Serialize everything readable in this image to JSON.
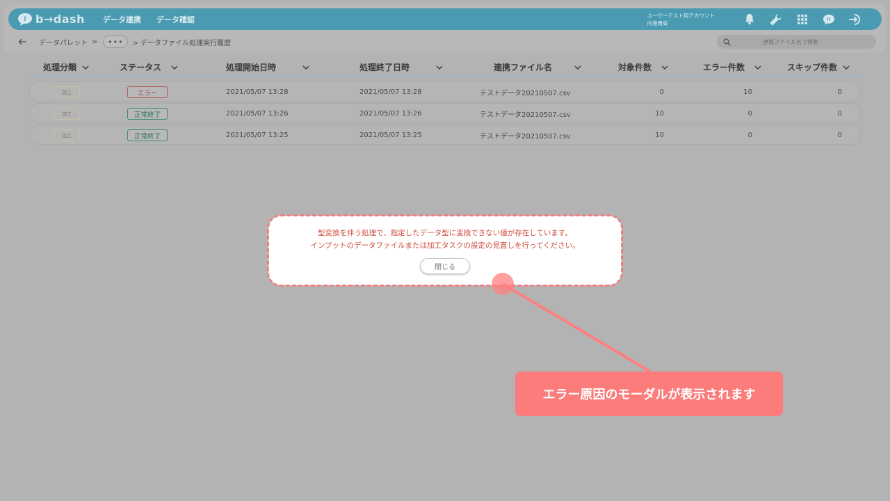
{
  "header": {
    "logo_text": "b→dash",
    "nav": [
      "データ連携",
      "データ確認"
    ],
    "user_line1": "ユーザーテスト用アカウント",
    "user_line2": "向後貴東"
  },
  "subbar": {
    "crumb1": "データパレット",
    "sep": ">",
    "more": "•••",
    "current": "> データファイル処理実行履歴",
    "search_placeholder": "連携ファイル名で検索"
  },
  "table": {
    "columns": [
      "処理分類",
      "ステータス",
      "処理開始日時",
      "処理終了日時",
      "連携ファイル名",
      "対象件数",
      "エラー件数",
      "スキップ件数"
    ],
    "rows": [
      {
        "type": "加工",
        "status": "エラー",
        "status_kind": "error",
        "start": "2021/05/07 13:28",
        "end": "2021/05/07 13:28",
        "file": "テストデータ20210507.csv",
        "target": "0",
        "errors": "10",
        "skips": "0"
      },
      {
        "type": "加工",
        "status": "正常終了",
        "status_kind": "ok",
        "start": "2021/05/07 13:26",
        "end": "2021/05/07 13:26",
        "file": "テストデータ20210507.csv",
        "target": "10",
        "errors": "0",
        "skips": "0"
      },
      {
        "type": "加工",
        "status": "正常終了",
        "status_kind": "ok",
        "start": "2021/05/07 13:25",
        "end": "2021/05/07 13:25",
        "file": "テストデータ20210507.csv",
        "target": "10",
        "errors": "0",
        "skips": "0"
      }
    ]
  },
  "modal": {
    "line1": "型変換を伴う処理で、指定したデータ型に変換できない値が存在しています。",
    "line2": "インプットのデータファイルまたは加工タスクの設定の見直しを行ってください。",
    "close_label": "閉じる"
  },
  "annotation": {
    "text": "エラー原因のモーダルが表示されます",
    "color": "#fc7b7b"
  }
}
